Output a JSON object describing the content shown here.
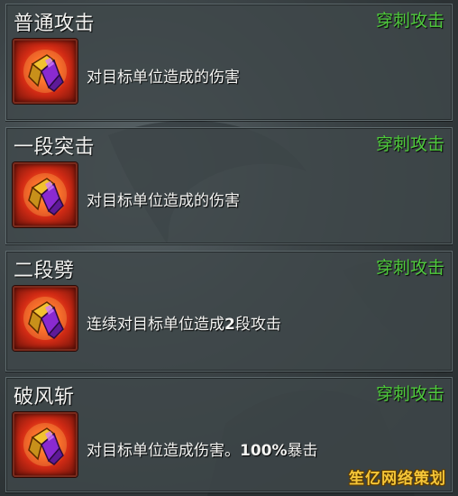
{
  "skills": [
    {
      "name": "普通攻击",
      "attack_type": "穿刺攻击",
      "description": "对目标单位造成的伤害",
      "icon": "purple-crystal-icon"
    },
    {
      "name": "一段突击",
      "attack_type": "穿刺攻击",
      "description": "对目标单位造成的伤害",
      "icon": "purple-crystal-icon"
    },
    {
      "name": "二段劈",
      "attack_type": "穿刺攻击",
      "description_pre": "连续对目标单位造成",
      "description_bold": "2",
      "description_post": "段攻击",
      "icon": "purple-crystal-icon"
    },
    {
      "name": "破风斩",
      "attack_type": "穿刺攻击",
      "description_pre": "对目标单位造成伤害。",
      "description_bold": "100%",
      "description_post": "暴击",
      "icon": "purple-crystal-icon"
    }
  ],
  "watermark": "笙亿网络策划",
  "colors": {
    "attack_type": "#4fca3c",
    "title": "#f2f2f0",
    "icon_border": "#7a2a1c"
  }
}
